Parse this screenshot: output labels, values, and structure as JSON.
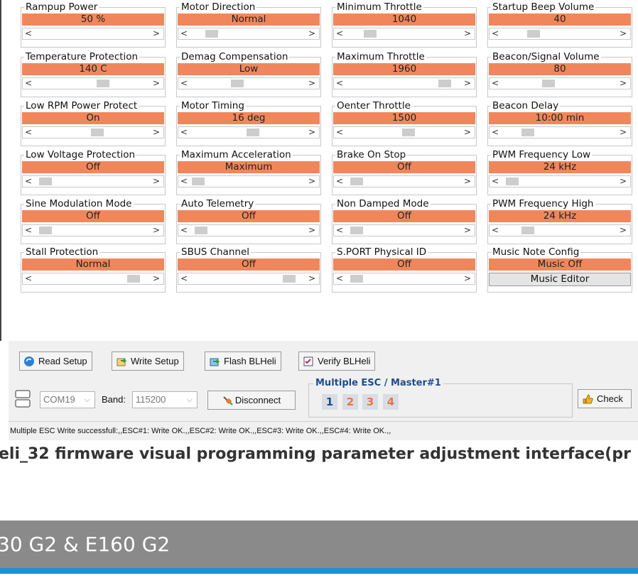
{
  "params": [
    [
      {
        "title": "Rampup Power",
        "value": "50 %",
        "thumb": 0
      },
      {
        "title": "Motor Direction",
        "value": "Normal",
        "thumb": 0.15
      },
      {
        "title": "Minimum Throttle",
        "value": "1040",
        "thumb": 0.18
      },
      {
        "title": "Startup Beep Volume",
        "value": "40",
        "thumb": 0.25
      }
    ],
    [
      {
        "title": "Temperature Protection",
        "value": "140 C",
        "thumb": 0.6
      },
      {
        "title": "Demag Compensation",
        "value": "Low",
        "thumb": 0.4
      },
      {
        "title": "Maximum Throttle",
        "value": "1960",
        "thumb": 0.9
      },
      {
        "title": "Beacon/Signal Volume",
        "value": "80",
        "thumb": 0.4
      }
    ],
    [
      {
        "title": "Low RPM Power Protect",
        "value": "On",
        "thumb": 0.55
      },
      {
        "title": "Motor Timing",
        "value": "16 deg",
        "thumb": 0.55
      },
      {
        "title": "Oenter Throttle",
        "value": "1500",
        "thumb": 0.55
      },
      {
        "title": "Beacon Delay",
        "value": "10:00 min",
        "thumb": 0.2
      }
    ],
    [
      {
        "title": "Low Voltage Protection",
        "value": "Off",
        "thumb": 0.05
      },
      {
        "title": "Maximum Acceleration",
        "value": "Maximum",
        "thumb": 0.02
      },
      {
        "title": "Brake On Stop",
        "value": "Off",
        "thumb": 0.05
      },
      {
        "title": "PWM Frequency Low",
        "value": "24 kHz",
        "thumb": 0.05
      }
    ],
    [
      {
        "title": "Sine Modulation Mode",
        "value": "Off",
        "thumb": 0.05
      },
      {
        "title": "Auto Telemetry",
        "value": "Off",
        "thumb": 0.05
      },
      {
        "title": "Non Damped Mode",
        "value": "Off",
        "thumb": 0.05
      },
      {
        "title": "PWM Frequency High",
        "value": "24 kHz",
        "thumb": 0.2
      }
    ],
    [
      {
        "title": "Stall Protection",
        "value": "Normal",
        "thumb": 0.9
      },
      {
        "title": "SBUS Channel",
        "value": "Off",
        "thumb": 0.9
      },
      {
        "title": "S.PORT Physical ID",
        "value": "Off",
        "thumb": 0.05
      },
      {
        "title": "Music Note Config",
        "value": "Music Off",
        "button": "Music Editor"
      }
    ]
  ],
  "toolbar": {
    "read_setup": "Read Setup",
    "write_setup": "Write Setup",
    "flash_blheli": "Flash BLHeli",
    "verify_blheli": "Verify BLHeli",
    "com_port": "COM19",
    "band_label": "Band:",
    "band_value": "115200",
    "disconnect": "Disconnect",
    "esc_group_title": "Multiple ESC / Master#1",
    "esc_numbers": [
      "1",
      "2",
      "3",
      "4"
    ],
    "check": "Check"
  },
  "status": "Multiple ESC Write successfull:,,ESC#1: Write OK.,,ESC#2: Write OK.,,ESC#3: Write  OK.,,ESC#4: Write OK.,,",
  "caption": "eli_32 firmware visual programming parameter adjustment interface(pr",
  "footer": "30 G2 & E160 G2",
  "colors": {
    "value_bar": "#f0875c",
    "esc_active": "#1f4d8c",
    "esc_inactive": "#e8754a",
    "footer_band": "#8a8a8a",
    "footer_stripe": "#1f8fd8"
  }
}
